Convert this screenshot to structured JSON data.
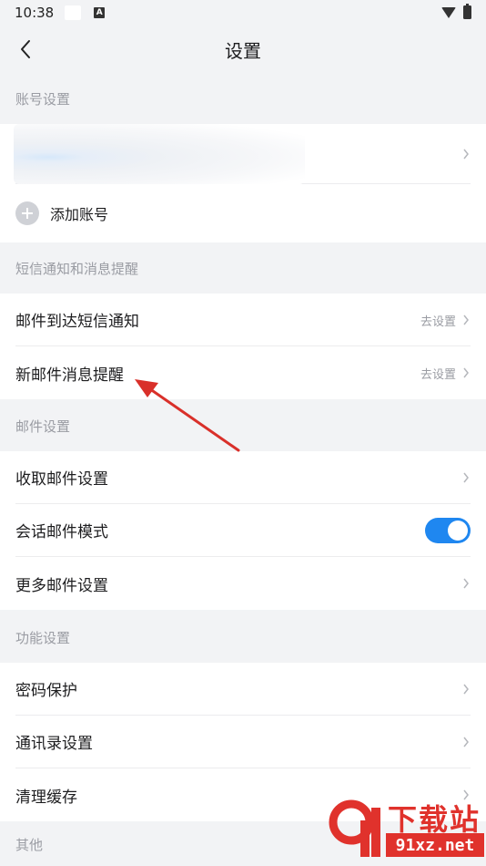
{
  "status": {
    "time": "10:38",
    "a_label": "A"
  },
  "nav": {
    "title": "设置"
  },
  "sections": {
    "account": "账号设置",
    "sms": "短信通知和消息提醒",
    "mail": "邮件设置",
    "function": "功能设置",
    "other": "其他"
  },
  "account": {
    "add_label": "添加账号"
  },
  "sms_rows": [
    {
      "label": "邮件到达短信通知",
      "value": "去设置"
    },
    {
      "label": "新邮件消息提醒",
      "value": "去设置"
    }
  ],
  "mail_rows": [
    {
      "label": "收取邮件设置"
    },
    {
      "label": "会话邮件模式",
      "toggle": true
    },
    {
      "label": "更多邮件设置"
    }
  ],
  "function_rows": [
    {
      "label": "密码保护"
    },
    {
      "label": "通讯录设置"
    },
    {
      "label": "清理缓存"
    }
  ],
  "watermark": {
    "brand": "下载站",
    "url": "91xz.net"
  },
  "colors": {
    "accent": "#1f87f0",
    "annotation": "#d9302a",
    "watermark": "#e0322c"
  }
}
